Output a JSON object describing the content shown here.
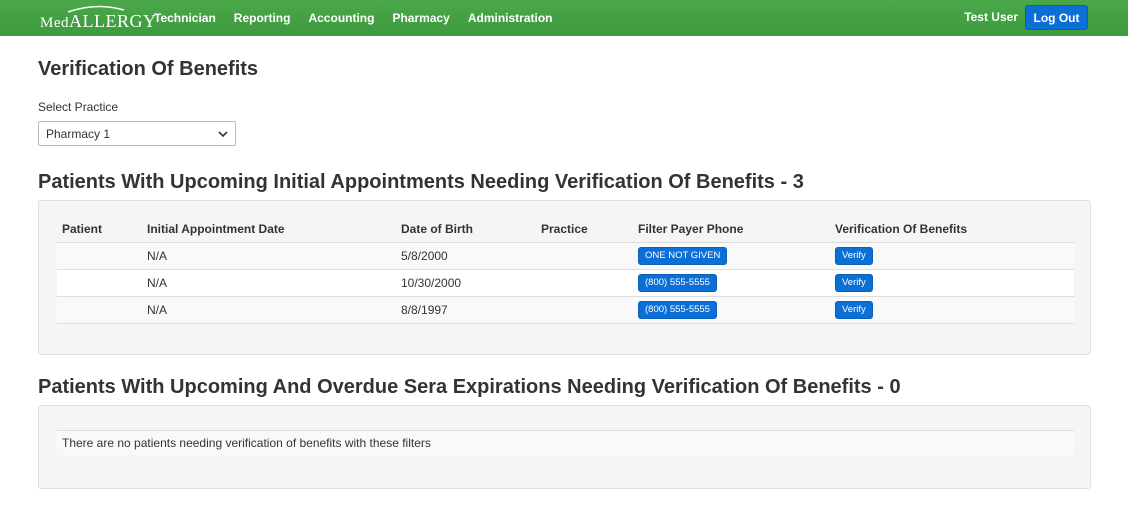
{
  "nav": {
    "brand": "MedAllergy",
    "brand_prefix": "Med",
    "brand_suffix": "ALLERGY",
    "links": [
      "Technician",
      "Reporting",
      "Accounting",
      "Pharmacy",
      "Administration"
    ],
    "user": "Test User",
    "logout": "Log Out"
  },
  "page": {
    "title": "Verification Of Benefits",
    "select_label": "Select Practice",
    "select_value": "Pharmacy 1"
  },
  "section1": {
    "title": "Patients With Upcoming Initial Appointments Needing Verification Of Benefits - 3",
    "columns": [
      "Patient",
      "Initial Appointment Date",
      "Date of Birth",
      "Practice",
      "Filter Payer Phone",
      "Verification Of Benefits"
    ],
    "rows": [
      {
        "patient": "",
        "appt": "N/A",
        "dob": "5/8/2000",
        "practice": "",
        "phone": "ONE NOT GIVEN",
        "action": "Verify"
      },
      {
        "patient": "",
        "appt": "N/A",
        "dob": "10/30/2000",
        "practice": "",
        "phone": "(800) 555-5555",
        "action": "Verify"
      },
      {
        "patient": "",
        "appt": "N/A",
        "dob": "8/8/1997",
        "practice": "",
        "phone": "(800) 555-5555",
        "action": "Verify"
      }
    ]
  },
  "section2": {
    "title": "Patients With Upcoming And Overdue Sera Expirations Needing Verification Of Benefits - 0",
    "empty_message": "There are no patients needing verification of benefits with these filters"
  },
  "colors": {
    "navbar": "#43a047",
    "accent": "#0b6fd6"
  }
}
